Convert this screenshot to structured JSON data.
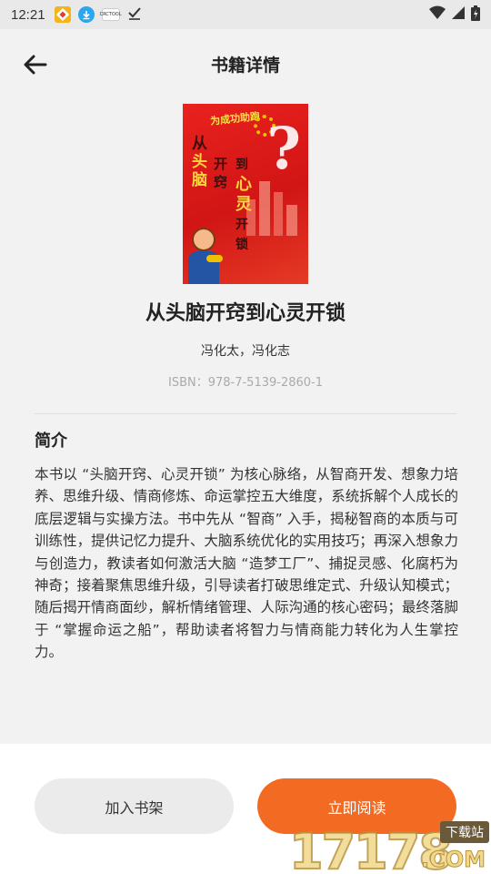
{
  "status_bar": {
    "time": "12:21",
    "notif_c_label": "CRCTOOL"
  },
  "header": {
    "title": "书籍详情"
  },
  "book": {
    "cover": {
      "banner": "为成功助跑",
      "col1_a": "从",
      "col1_b": "头",
      "col1_c": "脑",
      "col2": "开窍",
      "col3_a": "到",
      "col3_b": "心",
      "col3_c": "灵",
      "col3_d": "开锁"
    },
    "title": "从头脑开窍到心灵开锁",
    "authors": "冯化太，冯化志",
    "isbn": "ISBN：978-7-5139-2860-1"
  },
  "intro": {
    "heading": "简介",
    "body": "本书以 “头脑开窍、心灵开锁” 为核心脉络，从智商开发、想象力培养、思维升级、情商修炼、命运掌控五大维度，系统拆解个人成长的底层逻辑与实操方法。书中先从 “智商” 入手，揭秘智商的本质与可训练性，提供记忆力提升、大脑系统优化的实用技巧；再深入想象力与创造力，教读者如何激活大脑 “造梦工厂”、捕捉灵感、化腐朽为神奇；接着聚焦思维升级，引导读者打破思维定式、升级认知模式；随后揭开情商面纱，解析情绪管理、人际沟通的核心密码；最终落脚于 “掌握命运之船”，帮助读者将智力与情商能力转化为人生掌控力。"
  },
  "actions": {
    "add_shelf": "加入书架",
    "read_now": "立即阅读"
  },
  "watermark": {
    "digits": "17178",
    "tag": "下载站",
    "suffix": ".COM"
  },
  "colors": {
    "accent": "#f36a22",
    "background": "#f2f2f2"
  }
}
